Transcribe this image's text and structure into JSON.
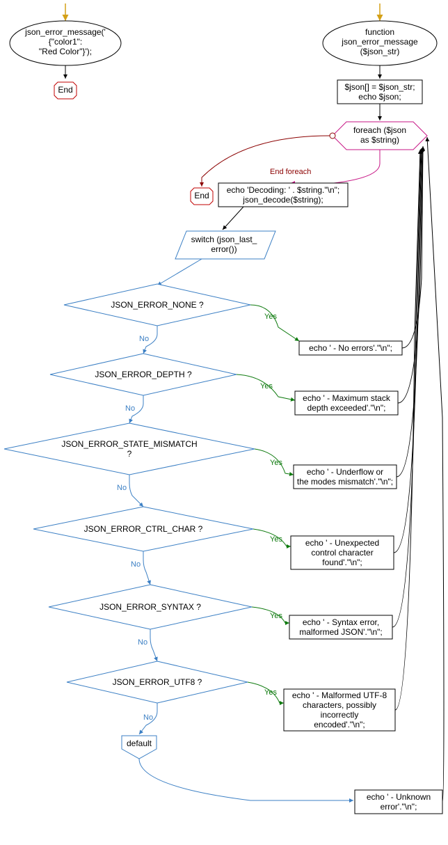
{
  "left_flow": {
    "start_call": "json_error_message('\n{\"color1\":\n\"Red Color\"}');",
    "end": "End"
  },
  "right_flow": {
    "func_decl": "function\njson_error_message\n($json_str)",
    "assign_block": "$json[] = $json_str;\necho $json;",
    "foreach": "foreach ($json\nas $string)",
    "end_foreach_label": "End foreach",
    "end": "End",
    "loop_body": "echo 'Decoding: ' . $string.\"\\n\";\njson_decode($string);",
    "switch": "switch (json_last_\nerror())",
    "cases": [
      {
        "cond": "JSON_ERROR_NONE ?",
        "action": "echo ' - No errors'.\"\\n\";"
      },
      {
        "cond": "JSON_ERROR_DEPTH ?",
        "action": "echo ' - Maximum stack\ndepth exceeded'.\"\\n\";"
      },
      {
        "cond": "JSON_ERROR_STATE_MISMATCH\n?",
        "action": "echo ' - Underflow or\nthe modes mismatch'.\"\\n\";"
      },
      {
        "cond": "JSON_ERROR_CTRL_CHAR ?",
        "action": "echo ' - Unexpected\ncontrol character\nfound'.\"\\n\";"
      },
      {
        "cond": "JSON_ERROR_SYNTAX ?",
        "action": "echo ' - Syntax error,\nmalformed JSON'.\"\\n\";"
      },
      {
        "cond": "JSON_ERROR_UTF8 ?",
        "action": "echo ' - Malformed UTF-8\ncharacters, possibly\nincorrectly\nencoded'.\"\\n\";"
      }
    ],
    "default_label": "default",
    "default_action": "echo ' - Unknown\nerror'.\"\\n\";",
    "yes": "Yes",
    "no": "No"
  },
  "colors": {
    "start_arrow": "#d4a017",
    "blue": "#3b7fc4",
    "magenta": "#c71585",
    "darkred": "#8b0000",
    "green": "#0e7a0e",
    "black": "#000000",
    "red": "#c00000"
  }
}
